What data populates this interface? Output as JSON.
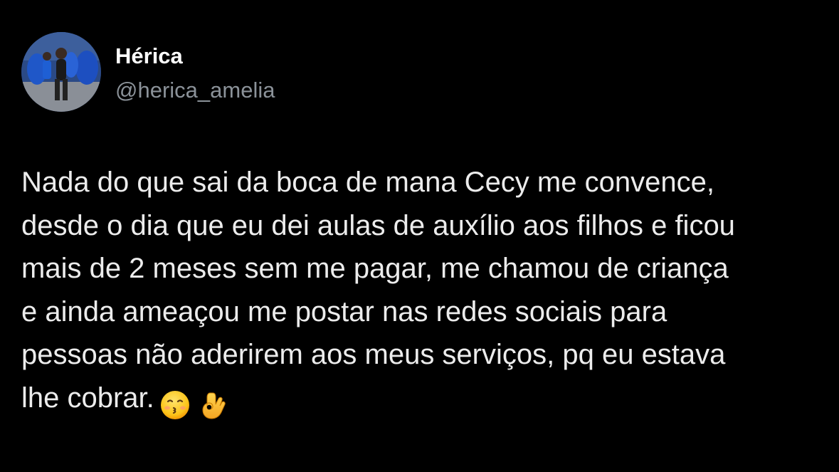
{
  "tweet": {
    "author": {
      "display_name": "Hérica",
      "handle": "@herica_amelia",
      "avatar_icon": "profile-photo"
    },
    "text": "Nada do que sai da boca de mana Cecy me convence,\ndesde o dia que eu dei aulas de auxílio aos filhos e ficou\nmais de 2 meses sem me pagar, me chamou de criança\ne ainda ameaçou me postar nas redes sociais para\npessoas não aderirem aos meus serviços, pq eu estava\nlhe cobrar.",
    "emojis": [
      "kissing-face-emoji",
      "ok-hand-emoji"
    ]
  },
  "colors": {
    "background": "#000000",
    "name": "#ffffff",
    "handle": "#8b9299",
    "text": "#ececec"
  }
}
